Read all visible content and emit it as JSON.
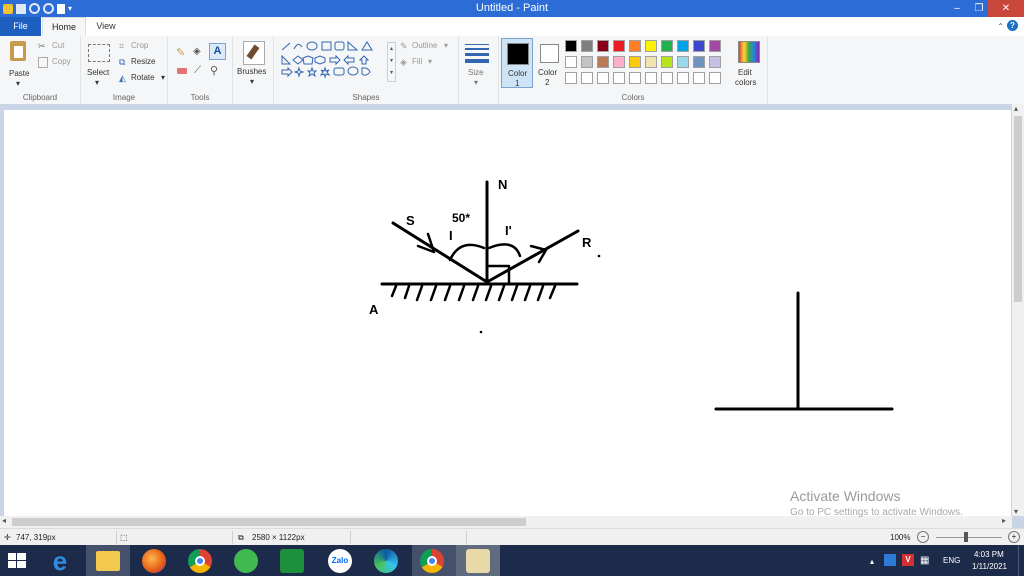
{
  "window": {
    "title": "Untitled - Paint",
    "minimize": "–",
    "maximize": "❐",
    "close": "✕"
  },
  "tabs": {
    "file": "File",
    "home": "Home",
    "view": "View",
    "help": "?"
  },
  "ribbon": {
    "clipboard": {
      "label": "Clipboard",
      "paste": "Paste",
      "cut": "Cut",
      "copy": "Copy"
    },
    "image": {
      "label": "Image",
      "select": "Select",
      "crop": "Crop",
      "resize": "Resize",
      "rotate": "Rotate"
    },
    "tools": {
      "label": "Tools"
    },
    "brushes": {
      "label": "Brushes"
    },
    "shapes": {
      "label": "Shapes",
      "outline": "Outline",
      "fill": "Fill"
    },
    "size": {
      "label": "Size"
    },
    "color1": {
      "label": "Color",
      "sub": "1",
      "value": "#000000"
    },
    "color2": {
      "label": "Color",
      "sub": "2",
      "value": "#ffffff"
    },
    "colors": {
      "label": "Colors",
      "edit": "Edit",
      "edit2": "colors",
      "palette": [
        "#000000",
        "#7f7f7f",
        "#880015",
        "#ed1c24",
        "#ff7f27",
        "#fff200",
        "#22b14c",
        "#00a2e8",
        "#3f48cc",
        "#a349a4",
        "#ffffff",
        "#c3c3c3",
        "#b97a57",
        "#ffaec9",
        "#ffc90e",
        "#efe4b0",
        "#b5e61d",
        "#99d9ea",
        "#7092be",
        "#c8bfe7"
      ]
    }
  },
  "drawing": {
    "n": "N",
    "s": "S",
    "r": "R",
    "a": "A",
    "angle": "50*",
    "i": "I",
    "i_prime": "I'"
  },
  "status": {
    "cursor": "747, 319px",
    "canvas_size": "2580 × 1122px",
    "zoom": "100%"
  },
  "watermark": {
    "line1": "Activate Windows",
    "line2": "Go to PC settings to activate Windows."
  },
  "taskbar": {
    "lang": "ENG",
    "time": "4:03 PM",
    "date": "1/11/2021",
    "zalo": "Zalo"
  }
}
